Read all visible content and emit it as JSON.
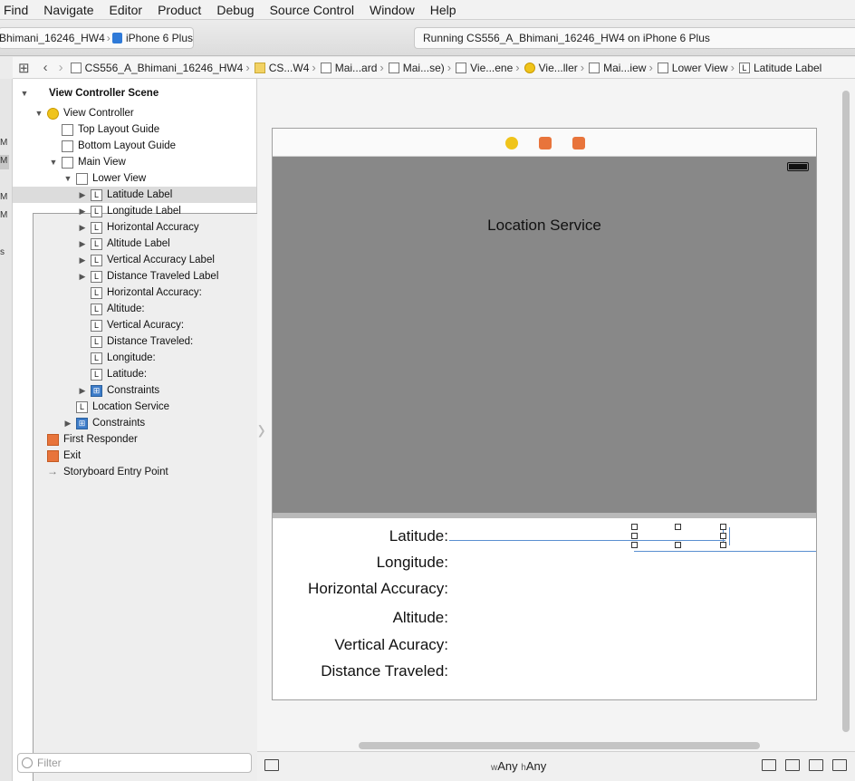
{
  "menubar": [
    "Find",
    "Navigate",
    "Editor",
    "Product",
    "Debug",
    "Source Control",
    "Window",
    "Help"
  ],
  "toolbar": {
    "scheme_project": "Bhimani_16246_HW4",
    "scheme_device": "iPhone 6 Plus",
    "status": "Running CS556_A_Bhimani_16246_HW4 on iPhone 6 Plus"
  },
  "jumpbar": [
    "CS556_A_Bhimani_16246_HW4",
    "CS...W4",
    "Mai...ard",
    "Mai...se)",
    "Vie...ene",
    "Vie...ller",
    "Mai...iew",
    "Lower View",
    "Latitude Label"
  ],
  "outline": {
    "scene": "View Controller Scene",
    "view_controller": "View Controller",
    "top_guide": "Top Layout Guide",
    "bottom_guide": "Bottom Layout Guide",
    "main_view": "Main View",
    "lower_view": "Lower View",
    "lower_items": [
      "Latitude Label",
      "Longitude Label",
      "Horizontal Accuracy",
      "Altitude Label",
      "Vertical Accuracy Label",
      "Distance Traveled Label",
      "Horizontal Accuracy:",
      "Altitude:",
      "Vertical Acuracy:",
      "Distance Traveled:",
      "Longitude:",
      "Latitude:",
      "Constraints"
    ],
    "location_service": "Location Service",
    "constraints": "Constraints",
    "first_responder": "First Responder",
    "exit": "Exit",
    "entry_point": "Storyboard Entry Point",
    "filter_placeholder": "Filter"
  },
  "left_strip": [
    "M",
    "M",
    "M",
    "M",
    "s"
  ],
  "canvas": {
    "title": "Location Service",
    "labels": [
      "Latitude:",
      "Longitude:",
      "Horizontal Accuracy:",
      "Altitude:",
      "Vertical Acuracy:",
      "Distance Traveled:"
    ]
  },
  "size_class": {
    "w_prefix": "w",
    "w": "Any",
    "h_prefix": "h",
    "h": "Any"
  },
  "colors": {
    "upper_view": "#888888",
    "selection": "#5a8fd0",
    "vc_icon": "#f0c41b",
    "responder_icon": "#e8743b",
    "constraints_icon": "#3d7cc9"
  }
}
